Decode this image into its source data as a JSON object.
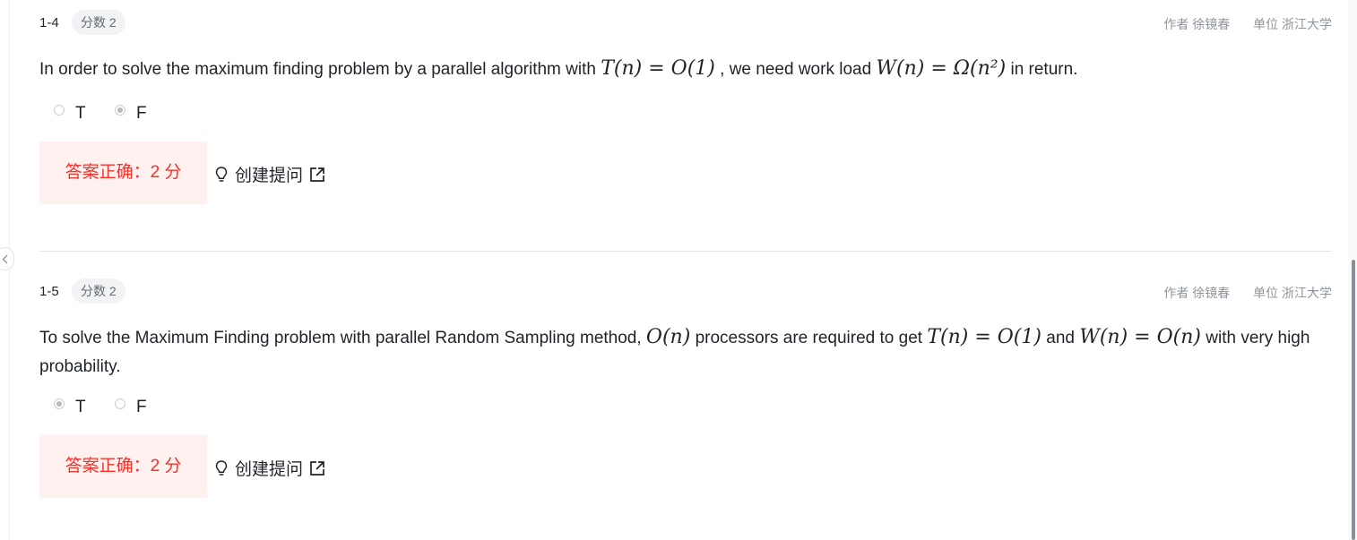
{
  "questions": [
    {
      "number": "1-4",
      "score_badge": "分数 2",
      "author": "作者 徐镜春",
      "unit": "单位 浙江大学",
      "text_parts": {
        "t1": "In order to solve the maximum finding problem by a parallel algorithm with ",
        "m1": "T(n) = O(1)",
        "t2": " , we need work load ",
        "m2": "W(n) = Ω(n²)",
        "t3": " in return."
      },
      "options": [
        {
          "label": "T",
          "checked": false
        },
        {
          "label": "F",
          "checked": true
        }
      ],
      "result": "答案正确：2 分",
      "ask_label": "创建提问"
    },
    {
      "number": "1-5",
      "score_badge": "分数 2",
      "author": "作者 徐镜春",
      "unit": "单位 浙江大学",
      "text_parts": {
        "t1": "To solve the Maximum Finding problem with parallel Random Sampling method, ",
        "m1": "O(n)",
        "t2": " processors are required to get ",
        "m2": "T(n) = O(1)",
        "t3": " and ",
        "m3": "W(n) = O(n)",
        "t4": " with very high probability."
      },
      "options": [
        {
          "label": "T",
          "checked": true
        },
        {
          "label": "F",
          "checked": false
        }
      ],
      "result": "答案正确：2 分",
      "ask_label": "创建提问"
    }
  ],
  "icons": {
    "collapse": "chevron-left-icon",
    "ask": "lightbulb-icon",
    "external": "external-link-icon"
  },
  "colors": {
    "correct_text": "#f5322a",
    "correct_bg": "#fef1f0"
  }
}
